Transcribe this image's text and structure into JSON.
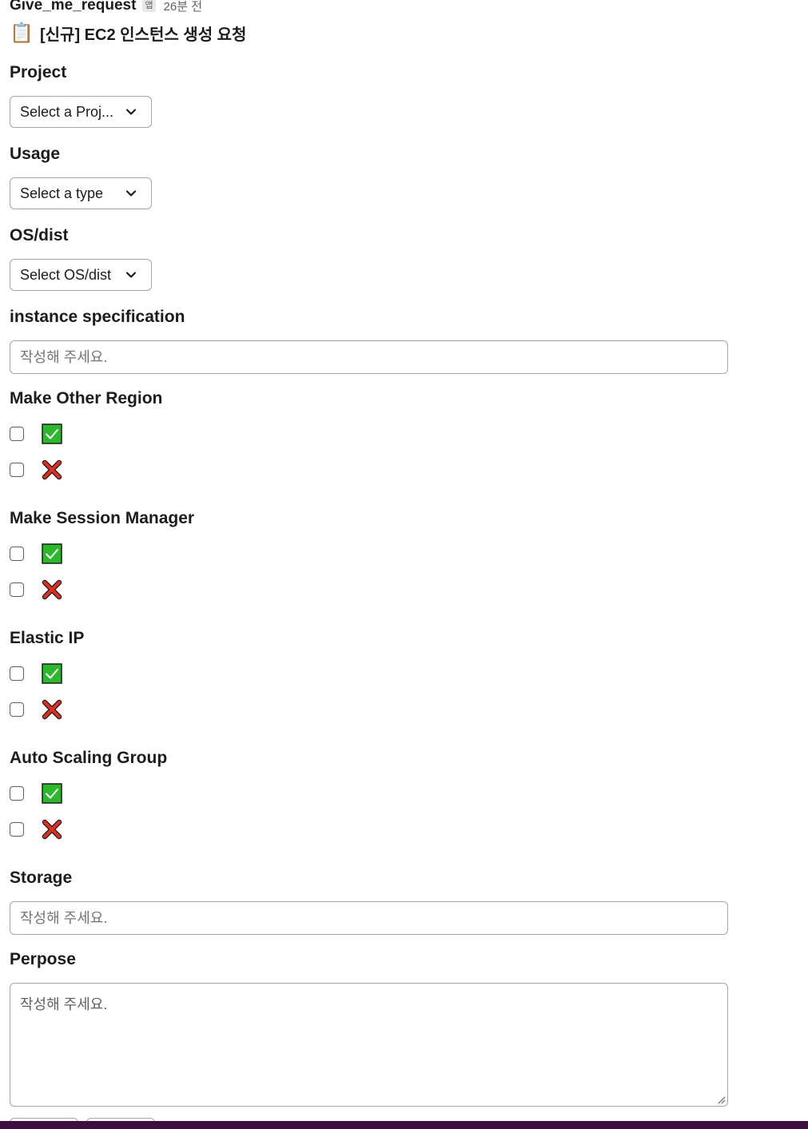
{
  "message": {
    "sender": "Give_me_request",
    "app_badge": "앱",
    "timestamp": "26분 전",
    "title_emoji": "📋",
    "title": "[신규] EC2 인스턴스 생성 요청"
  },
  "form": {
    "project": {
      "label": "Project",
      "placeholder": "Select a Proj..."
    },
    "usage": {
      "label": "Usage",
      "placeholder": "Select a type"
    },
    "os": {
      "label": "OS/dist",
      "placeholder": "Select OS/dist"
    },
    "instance_spec": {
      "label": "instance specification",
      "placeholder": "작성해 주세요."
    },
    "make_other_region": {
      "label": "Make Other Region"
    },
    "make_session_manager": {
      "label": "Make Session Manager"
    },
    "elastic_ip": {
      "label": "Elastic IP"
    },
    "auto_scaling_group": {
      "label": "Auto Scaling Group"
    },
    "storage": {
      "label": "Storage",
      "placeholder": "작성해 주세요."
    },
    "purpose": {
      "label": "Perpose",
      "placeholder": "작성해 주세요."
    }
  },
  "icons": {
    "yes": "white-check-mark-icon",
    "no": "x-mark-icon",
    "chevron": "chevron-down-icon"
  },
  "colors": {
    "check_green": "#2cb82c",
    "cross_red": "#dd2e23",
    "bottom_bar": "#3f0e40"
  }
}
